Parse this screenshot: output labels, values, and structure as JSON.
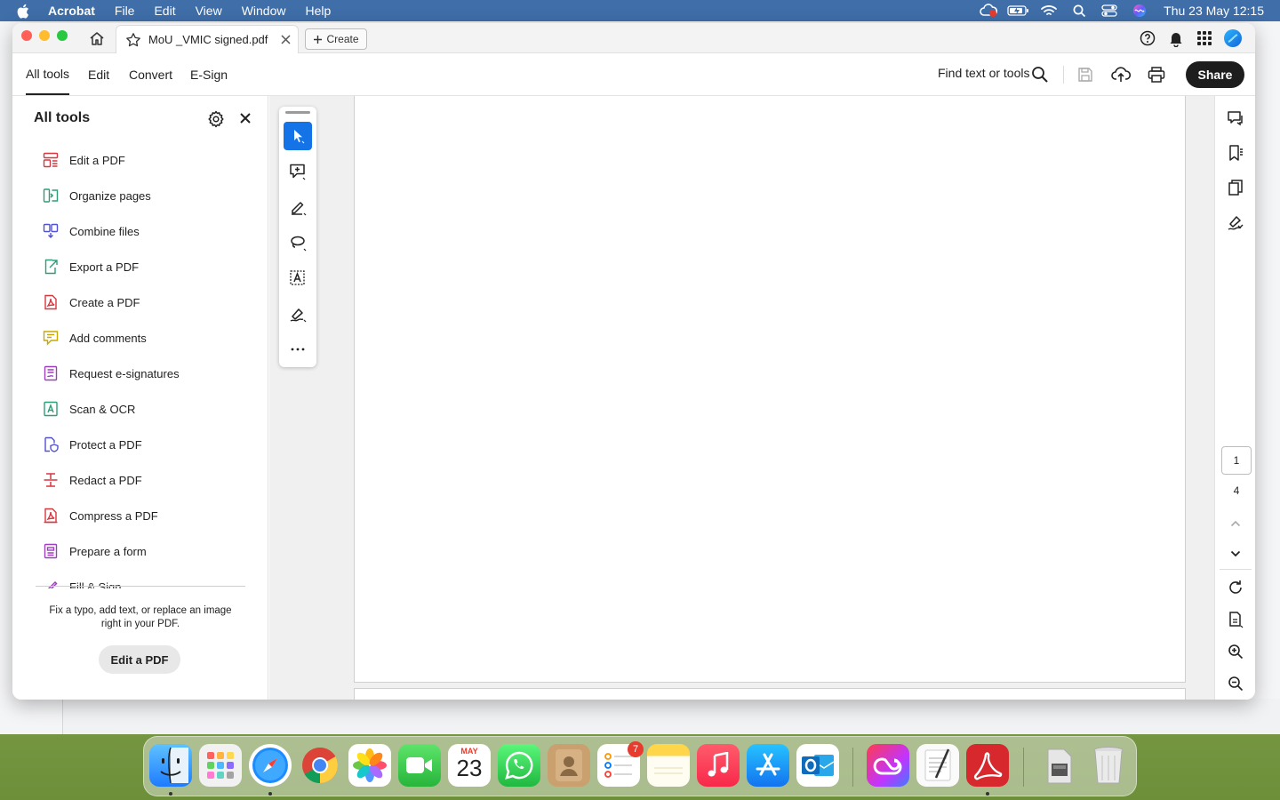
{
  "menubar": {
    "app": "Acrobat",
    "menus": [
      "File",
      "Edit",
      "View",
      "Window",
      "Help"
    ],
    "clock": "Thu 23 May  12:15"
  },
  "titlebar": {
    "tab_title": "MoU _VMIC signed.pdf",
    "create_label": "Create"
  },
  "toolbar": {
    "tabs": [
      "All tools",
      "Edit",
      "Convert",
      "E-Sign"
    ],
    "active_tab": "All tools",
    "find_label": "Find text or tools",
    "share_label": "Share"
  },
  "left_panel": {
    "title": "All tools",
    "tools": [
      {
        "label": "Edit a PDF",
        "icon": "edit-pdf-icon",
        "color": "#d7373f"
      },
      {
        "label": "Organize pages",
        "icon": "organize-pages-icon",
        "color": "#2d9d78"
      },
      {
        "label": "Combine files",
        "icon": "combine-files-icon",
        "color": "#5151d3"
      },
      {
        "label": "Export a PDF",
        "icon": "export-pdf-icon",
        "color": "#2d9d78"
      },
      {
        "label": "Create a PDF",
        "icon": "create-pdf-icon",
        "color": "#d7373f"
      },
      {
        "label": "Add comments",
        "icon": "add-comments-icon",
        "color": "#c9a800"
      },
      {
        "label": "Request e-signatures",
        "icon": "request-esign-icon",
        "color": "#9c3fbf"
      },
      {
        "label": "Scan & OCR",
        "icon": "scan-ocr-icon",
        "color": "#2d9d78"
      },
      {
        "label": "Protect a PDF",
        "icon": "protect-pdf-icon",
        "color": "#5151d3"
      },
      {
        "label": "Redact a PDF",
        "icon": "redact-pdf-icon",
        "color": "#d7373f"
      },
      {
        "label": "Compress a PDF",
        "icon": "compress-pdf-icon",
        "color": "#d7373f"
      },
      {
        "label": "Prepare a form",
        "icon": "prepare-form-icon",
        "color": "#9c3fbf"
      },
      {
        "label": "Fill & Sign",
        "icon": "fill-sign-icon",
        "color": "#9c3fbf"
      }
    ],
    "tip": "Fix a typo, add text, or replace an image right in your PDF.",
    "tip_button": "Edit a PDF"
  },
  "quick_tools": [
    "select-cursor-icon",
    "add-comment-icon",
    "highlight-pen-icon",
    "draw-lasso-icon",
    "text-recognize-icon",
    "sign-pen-icon",
    "more-options-icon"
  ],
  "right_rail": {
    "current_page": "1",
    "total_pages": "4"
  },
  "dock": {
    "apps": [
      "Finder",
      "Launchpad",
      "Safari",
      "Chrome",
      "Photos",
      "FaceTime",
      "Calendar",
      "WhatsApp",
      "Contacts",
      "Reminders",
      "Notes",
      "Music",
      "App Store",
      "Outlook",
      "Creative Cloud",
      "TextEdit",
      "Acrobat",
      "Utility",
      "Trash"
    ],
    "calendar_month": "MAY",
    "calendar_day": "23",
    "reminders_badge": "7"
  }
}
